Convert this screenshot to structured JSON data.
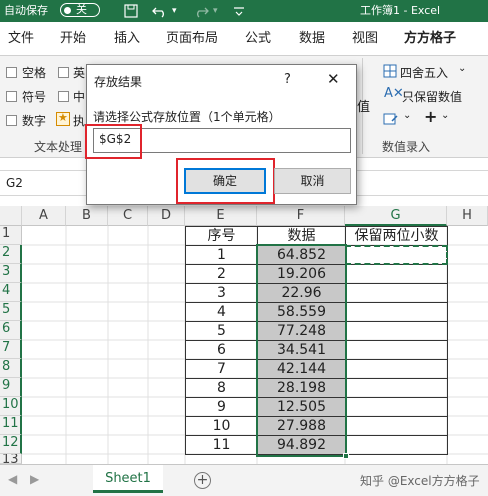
{
  "titlebar": {
    "autosave_label": "自动保存",
    "autosave_state": "关",
    "workbook": "工作簿1  -  Excel"
  },
  "ribbon_tabs": [
    "文件",
    "开始",
    "插入",
    "页面布局",
    "公式",
    "数据",
    "视图",
    "方方格子"
  ],
  "ribbon": {
    "checks": [
      "空格",
      "英",
      "符号",
      "中",
      "数字",
      "执"
    ],
    "group_text_label": "文本处理",
    "round_label": "四舍五入",
    "keep_value_label": "只保留数值",
    "value_label": "值",
    "group_value_label": "数值录入"
  },
  "formula_bar": {
    "name_box": "G2"
  },
  "columns": [
    "A",
    "B",
    "C",
    "D",
    "E",
    "F",
    "G",
    "H"
  ],
  "rows": [
    "1",
    "2",
    "3",
    "4",
    "5",
    "6",
    "7",
    "8",
    "9",
    "10",
    "11",
    "12",
    "13"
  ],
  "table": {
    "headers": [
      "序号",
      "数据",
      "保留两位小数"
    ],
    "ids": [
      "1",
      "2",
      "3",
      "4",
      "5",
      "6",
      "7",
      "8",
      "9",
      "10",
      "11"
    ],
    "values": [
      "64.852",
      "19.206",
      "22.96",
      "58.559",
      "77.248",
      "34.541",
      "42.144",
      "28.198",
      "12.505",
      "27.988",
      "94.892"
    ]
  },
  "dialog": {
    "title": "存放结果",
    "help": "?",
    "close": "✕",
    "prompt": "请选择公式存放位置（1个单元格）",
    "input_value": "$G$2",
    "ok_label": "确定",
    "cancel_label": "取消"
  },
  "sheet_tabs": {
    "active": "Sheet1",
    "add": "+"
  },
  "watermark": "知乎 @Excel方方格子",
  "colors": {
    "excel_green": "#217346",
    "highlight_red": "#e0242c",
    "dialog_blue": "#0078d7"
  }
}
